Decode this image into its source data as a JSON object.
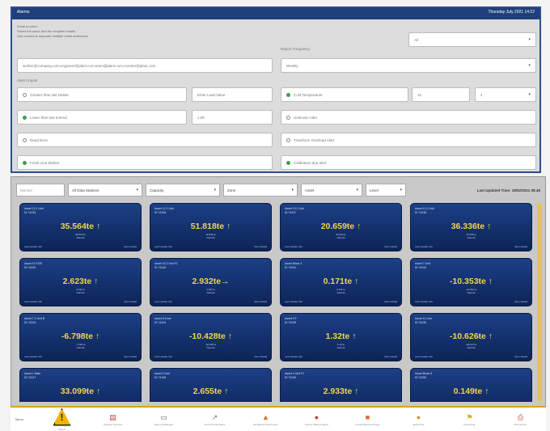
{
  "header": {
    "left_title": "Alarms",
    "right_timestamp": "Thursday July 2021 14:22"
  },
  "config": {
    "intro_lines": [
      "Email to alarm",
      "Select the users and the recipient emails",
      "Use comma to separate multiple email addresses"
    ],
    "recipients_value": "worker@company.com,engineer@plant.com,team@plant.com,monitor@plant.com",
    "report_frequency_label": "Report Frequency",
    "report_frequency_value": "Weekly",
    "top_right_select": "All",
    "alarm_inputs_label": "Alarm Inputs",
    "rows_left": [
      {
        "label": "Greater than last Delete",
        "on": false
      },
      {
        "label": "Lower than last Extend",
        "on": true
      },
      {
        "label": "Dead Error",
        "on": false
      },
      {
        "label": "Fresh Line Marker",
        "on": true
      }
    ],
    "left_small_fields": [
      "Enter Load Value",
      "1.00"
    ],
    "rows_right": [
      {
        "label": "Cold Temperature",
        "on": true
      },
      {
        "label": "Unknown Alert",
        "on": false
      },
      {
        "label": "Transform Overload Alert",
        "on": false
      },
      {
        "label": "Calibration due alert",
        "on": true
      }
    ],
    "right_small_fields": [
      "10",
      "4"
    ]
  },
  "toolbar": {
    "tab": "Monitor",
    "selects": [
      "All Data Stations",
      "Capacity",
      "Zone",
      "Asset",
      "Level"
    ],
    "last_updated": "Last Updated Time: 18/02/2021 08:45"
  },
  "tiles": [
    {
      "name": "Asset 12.1 Unit",
      "sub": "ID 74235",
      "value": "35.564te ↑",
      "stat1": "28.413 te",
      "stat2": "Normal"
    },
    {
      "name": "Asset 12.2 Unit",
      "sub": "ID 74236",
      "value": "51.818te ↑",
      "stat1": "11.843 te",
      "stat2": "Normal"
    },
    {
      "name": "Asset 13.1 Unit",
      "sub": "ID 74237",
      "value": "20.659te ↑",
      "stat1": "09.422 te",
      "stat2": "Normal"
    },
    {
      "name": "Asset 13.2 Unit",
      "sub": "ID 74238",
      "value": "36.336te ↑",
      "stat1": "14.165 te",
      "stat2": "Normal"
    },
    {
      "name": "Asset 14 F2/E",
      "sub": "ID 74239",
      "value": "2.623te ↑",
      "stat1": "3.311 te",
      "stat2": "Normal"
    },
    {
      "name": "Asset 15.2 Unit F1",
      "sub": "ID 74240",
      "value": "2.932te→",
      "stat1": "3.331 te",
      "stat2": "Normal"
    },
    {
      "name": "Asset Block 4",
      "sub": "ID 74241",
      "value": "0.171te ↑",
      "stat1": "0.211 te",
      "stat2": "Normal"
    },
    {
      "name": "Asset 7 Unit",
      "sub": "ID 74242",
      "value": "-10.353te ↑",
      "stat1": "-13.293 te",
      "stat2": "Normal"
    },
    {
      "name": "Asset 7.2 Unit B",
      "sub": "ID 74243",
      "value": "-6.798te ↑",
      "stat1": "-7.432 te",
      "stat2": "Normal"
    },
    {
      "name": "Asset 8 Zone",
      "sub": "ID 74244",
      "value": "-10.428te ↑",
      "stat1": "-10.328 te",
      "stat2": "Normal"
    },
    {
      "name": "Asset 9 F",
      "sub": "ID 74245",
      "value": "1.32te ↑",
      "stat1": "1.44 te",
      "stat2": "Normal"
    },
    {
      "name": "Asset 10 Line",
      "sub": "ID 74246",
      "value": "-10.626te ↑",
      "stat1": "-10.117 te",
      "stat2": "Normal"
    },
    {
      "name": "Asset 1 Main",
      "sub": "ID 74247",
      "value": "33.099te ↑",
      "stat1": "",
      "stat2": ""
    },
    {
      "name": "Asset 2 Unit",
      "sub": "ID 74248",
      "value": "2.655te ↑",
      "stat1": "",
      "stat2": ""
    },
    {
      "name": "Asset 3 Unit F1",
      "sub": "ID 74249",
      "value": "2.933te ↑",
      "stat1": "",
      "stat2": ""
    },
    {
      "name": "Asset Block 5",
      "sub": "ID 74250",
      "value": "0.149te ↑",
      "stat1": "",
      "stat2": ""
    }
  ],
  "tile_footer": {
    "left": "Last Update Info",
    "right": "Open Detail"
  },
  "appbar": {
    "left_label": "Menu",
    "items": [
      {
        "icon": "⚠",
        "label": "Alarms"
      },
      {
        "icon": "▤",
        "label": "Capacity Overview"
      },
      {
        "icon": "▭",
        "label": "Asset List Manager"
      },
      {
        "icon": "↗",
        "label": "Current Performance"
      },
      {
        "icon": "▲",
        "label": "All Stations Performance"
      },
      {
        "icon": "●",
        "label": "Current Stations Report"
      },
      {
        "icon": "■",
        "label": "Current Planned Outage"
      },
      {
        "icon": "●",
        "label": "Export File"
      },
      {
        "icon": "⚑",
        "label": "Documents"
      },
      {
        "icon": "⎙",
        "label": "Print Screen"
      }
    ]
  }
}
